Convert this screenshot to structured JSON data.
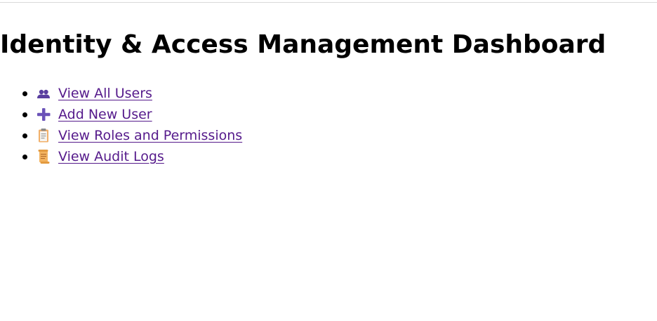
{
  "page": {
    "title": "Identity & Access Management Dashboard"
  },
  "menu": {
    "items": [
      {
        "label": "View All Users",
        "icon": "users-icon"
      },
      {
        "label": "Add New User",
        "icon": "plus-icon"
      },
      {
        "label": "View Roles and Permissions",
        "icon": "clipboard-icon"
      },
      {
        "label": "View Audit Logs",
        "icon": "scroll-icon"
      }
    ]
  },
  "colors": {
    "link_visited": "#551a8b",
    "icon_purple": "#6b52b8",
    "clipboard_body": "#f1b06a",
    "scroll_body": "#f3b35f"
  }
}
